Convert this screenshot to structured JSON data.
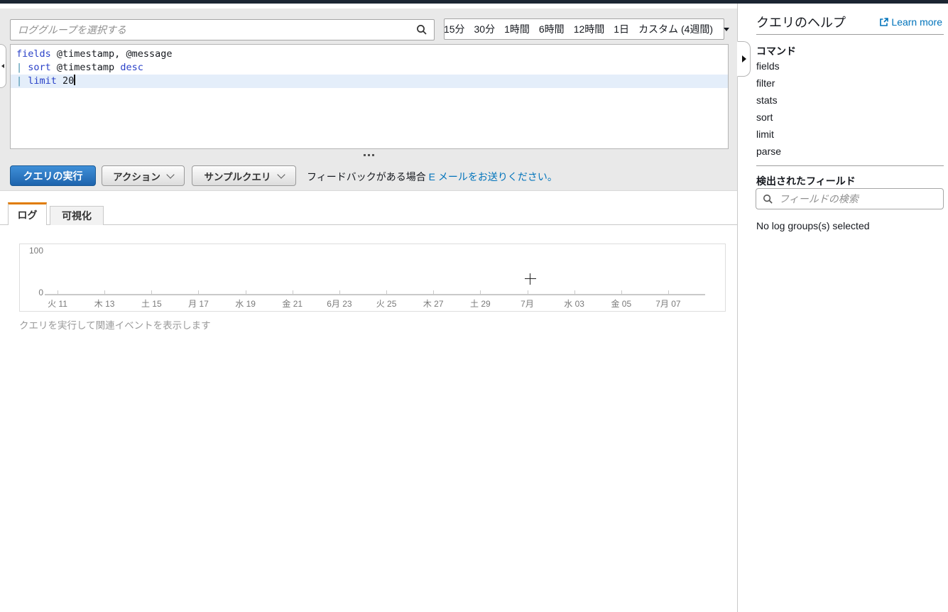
{
  "colors": {
    "accent_blue": "#1e6ebd",
    "link_blue": "#0073bb",
    "tab_orange": "#e07c00",
    "keyword_blue": "#2a41c8",
    "pipe_teal": "#3c8dab",
    "panel_gray": "#e9e9e9"
  },
  "log_group_search": {
    "placeholder": "ロググループを選択する"
  },
  "time_selector": {
    "options": [
      "15分",
      "30分",
      "1時間",
      "6時間",
      "12時間",
      "1日",
      "カスタム (4週間)"
    ]
  },
  "editor": {
    "lines": [
      {
        "highlighted": false,
        "cursor": false,
        "tokens": [
          {
            "text": "fields",
            "type": "keyword"
          },
          {
            "text": " @timestamp, @message",
            "type": "plain"
          }
        ]
      },
      {
        "highlighted": false,
        "cursor": false,
        "tokens": [
          {
            "text": "| ",
            "type": "pipe"
          },
          {
            "text": "sort",
            "type": "keyword"
          },
          {
            "text": " @timestamp ",
            "type": "plain"
          },
          {
            "text": "desc",
            "type": "keyword"
          }
        ]
      },
      {
        "highlighted": true,
        "cursor": true,
        "tokens": [
          {
            "text": "| ",
            "type": "pipe"
          },
          {
            "text": "limit",
            "type": "keyword"
          },
          {
            "text": " 20",
            "type": "plain"
          }
        ]
      }
    ]
  },
  "toolbar": {
    "run_label": "クエリの実行",
    "actions_label": "アクション",
    "samples_label": "サンプルクエリ",
    "feedback_text": "フィードバックがある場合 ",
    "feedback_link": "E メールをお送りください。"
  },
  "tabs": [
    {
      "label": "ログ",
      "active": true
    },
    {
      "label": "可視化",
      "active": false
    }
  ],
  "chart_data": {
    "type": "line",
    "title": "",
    "xlabel": "",
    "ylabel": "",
    "categories": [
      "火 11",
      "木 13",
      "土 15",
      "月 17",
      "水 19",
      "金 21",
      "6月 23",
      "火 25",
      "木 27",
      "土 29",
      "7月",
      "水 03",
      "金 05",
      "7月 07"
    ],
    "series": [],
    "ylim": [
      0,
      100
    ],
    "yticks": [
      100,
      0
    ],
    "grid": false,
    "legend": "none"
  },
  "chart_hint": "クエリを実行して関連イベントを表示します",
  "sidebar": {
    "title": "クエリのヘルプ",
    "learn_more_label": "Learn more",
    "commands_heading": "コマンド",
    "commands": [
      "fields",
      "filter",
      "stats",
      "sort",
      "limit",
      "parse"
    ],
    "fields_heading": "検出されたフィールド",
    "field_search_placeholder": "フィールドの検索",
    "empty_message": "No log groups(s) selected"
  }
}
